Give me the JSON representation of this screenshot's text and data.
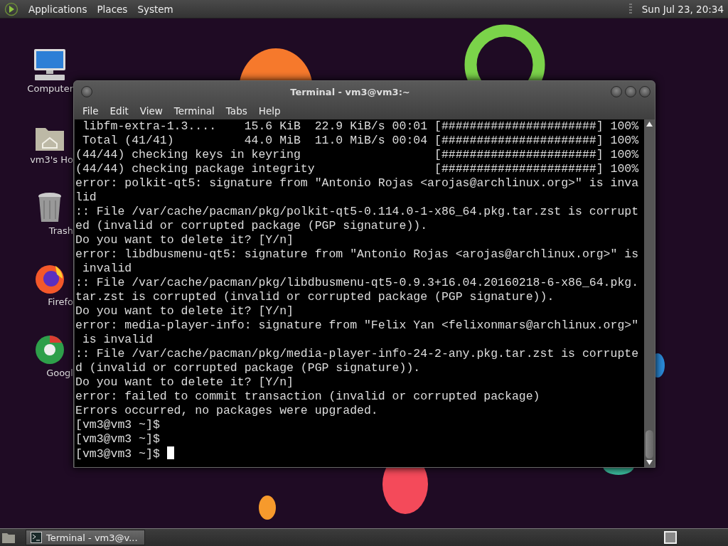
{
  "top_panel": {
    "menus": [
      "Applications",
      "Places",
      "System"
    ],
    "clock": "Sun Jul 23, 20:34"
  },
  "desktop_icons": [
    {
      "kind": "computer",
      "label": "Computer"
    },
    {
      "kind": "home",
      "label": "vm3's Ho"
    },
    {
      "kind": "trash",
      "label": "Trash"
    },
    {
      "kind": "firefox",
      "label": "Firefo"
    },
    {
      "kind": "chrome",
      "label": "Googl"
    }
  ],
  "terminal": {
    "title": "Terminal - vm3@vm3:~",
    "menu": [
      "File",
      "Edit",
      "View",
      "Terminal",
      "Tabs",
      "Help"
    ],
    "lines": [
      " libfm-extra-1.3....    15.6 KiB  22.9 KiB/s 00:01 [######################] 100%",
      " Total (41/41)          44.0 MiB  11.0 MiB/s 00:04 [######################] 100%",
      "(44/44) checking keys in keyring                   [######################] 100%",
      "(44/44) checking package integrity                 [######################] 100%",
      "error: polkit-qt5: signature from \"Antonio Rojas <arojas@archlinux.org>\" is inva",
      "lid",
      ":: File /var/cache/pacman/pkg/polkit-qt5-0.114.0-1-x86_64.pkg.tar.zst is corrupt",
      "ed (invalid or corrupted package (PGP signature)).",
      "Do you want to delete it? [Y/n]",
      "error: libdbusmenu-qt5: signature from \"Antonio Rojas <arojas@archlinux.org>\" is",
      " invalid",
      ":: File /var/cache/pacman/pkg/libdbusmenu-qt5-0.9.3+16.04.20160218-6-x86_64.pkg.",
      "tar.zst is corrupted (invalid or corrupted package (PGP signature)).",
      "Do you want to delete it? [Y/n]",
      "error: media-player-info: signature from \"Felix Yan <felixonmars@archlinux.org>\"",
      " is invalid",
      ":: File /var/cache/pacman/pkg/media-player-info-24-2-any.pkg.tar.zst is corrupte",
      "d (invalid or corrupted package (PGP signature)).",
      "Do you want to delete it? [Y/n]",
      "error: failed to commit transaction (invalid or corrupted package)",
      "Errors occurred, no packages were upgraded.",
      "[vm3@vm3 ~]$",
      "[vm3@vm3 ~]$",
      "[vm3@vm3 ~]$ "
    ]
  },
  "taskbar": {
    "tasks": [
      {
        "label": "Terminal - vm3@v..."
      }
    ]
  }
}
